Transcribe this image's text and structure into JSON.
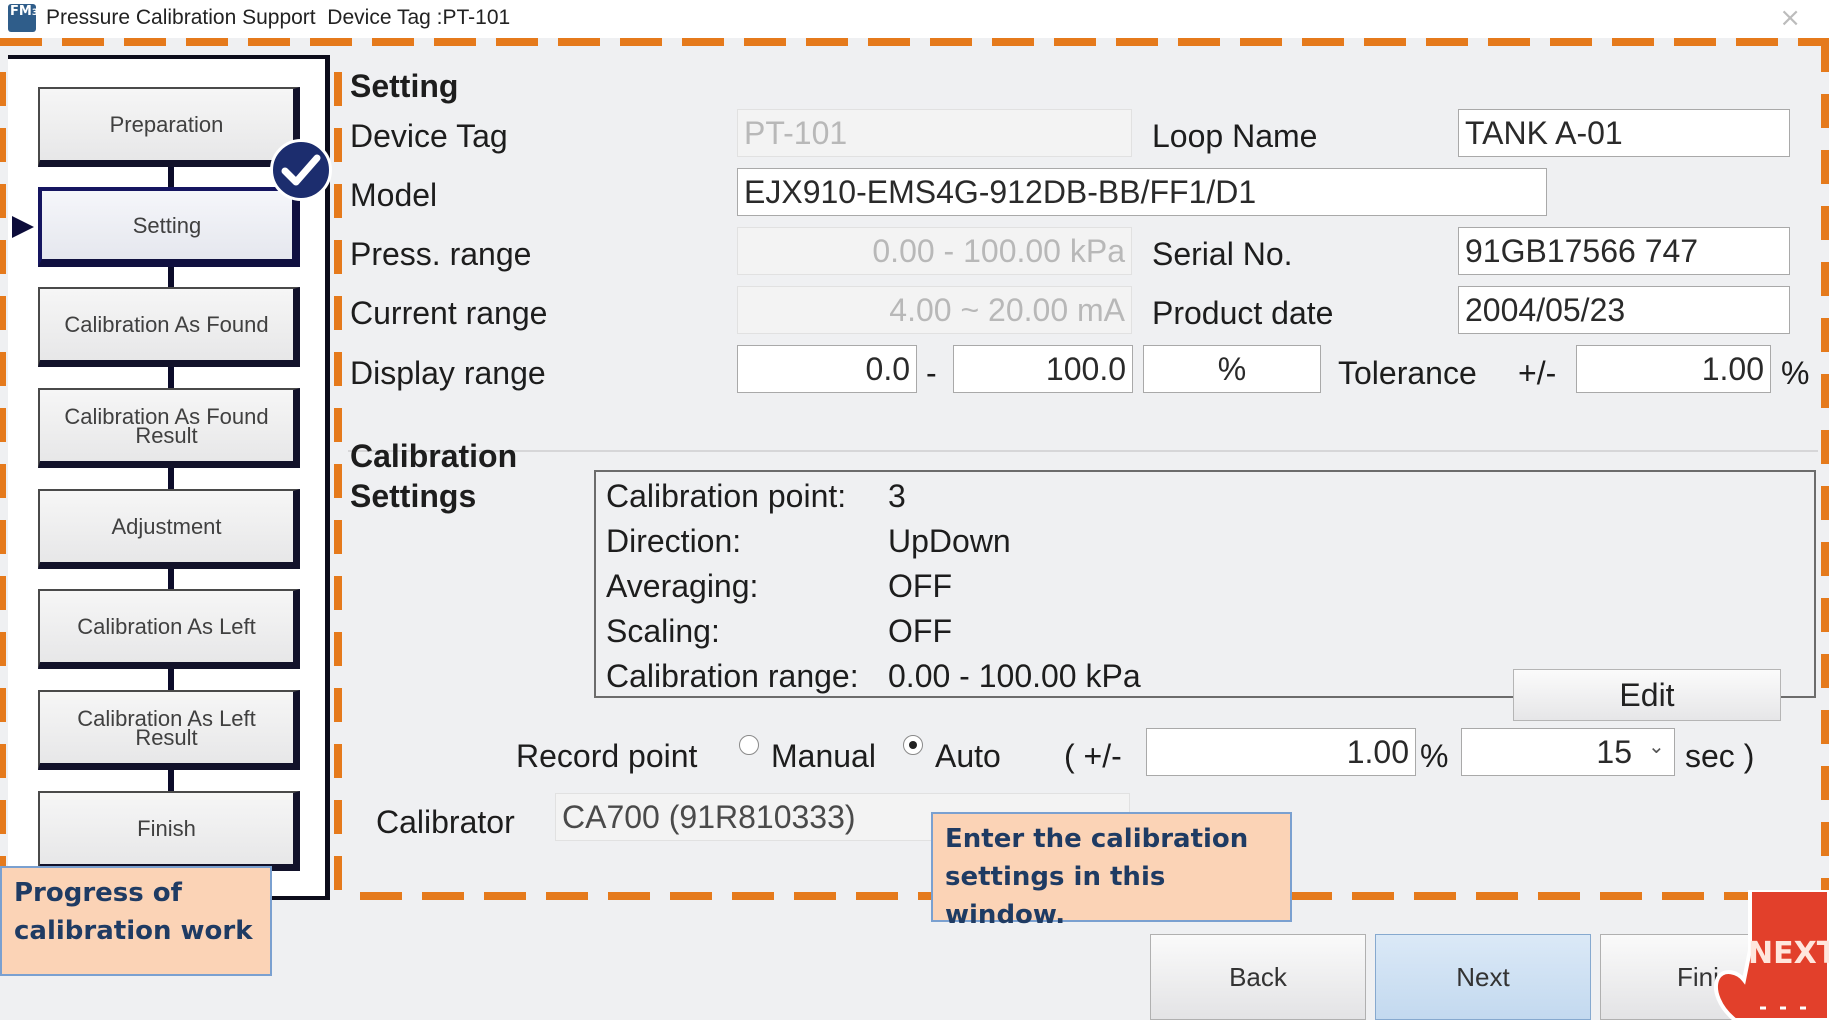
{
  "window": {
    "title": "Pressure Calibration Support  Device Tag :PT-101",
    "app_icon": "FM",
    "app_icon_sub": "3",
    "close_icon": "×"
  },
  "steps": [
    {
      "label": "Preparation",
      "state": "done"
    },
    {
      "label": "Setting",
      "state": "current"
    },
    {
      "label": "Calibration As Found",
      "state": "pending"
    },
    {
      "label": "Calibration As Found Result",
      "state": "pending"
    },
    {
      "label": "Adjustment",
      "state": "pending"
    },
    {
      "label": "Calibration As Left",
      "state": "pending"
    },
    {
      "label": "Calibration As Left Result",
      "state": "pending"
    },
    {
      "label": "Finish",
      "state": "pending"
    }
  ],
  "setting": {
    "section_title": "Setting",
    "device_tag_label": "Device Tag",
    "device_tag": "PT-101",
    "loop_name_label": "Loop Name",
    "loop_name": "TANK A-01",
    "model_label": "Model",
    "model": "EJX910-EMS4G-912DB-BB/FF1/D1",
    "press_range_label": "Press. range",
    "press_range": "0.00 - 100.00 kPa",
    "serial_label": "Serial No.",
    "serial": "91GB17566 747",
    "current_range_label": "Current range",
    "current_range": "4.00 ~ 20.00 mA",
    "product_date_label": "Product date",
    "product_date": "2004/05/23",
    "display_range_label": "Display range",
    "display_min": "0.0",
    "display_dash": "-",
    "display_max": "100.0",
    "display_unit": "%",
    "tolerance_label": "Tolerance",
    "tolerance_pm": "+/-",
    "tolerance": "1.00",
    "tolerance_unit": "%"
  },
  "calibration": {
    "section_title_1": "Calibration",
    "section_title_2": "Settings",
    "rows": [
      {
        "label": "Calibration point:",
        "value": "3"
      },
      {
        "label": "Direction:",
        "value": "UpDown"
      },
      {
        "label": "Averaging:",
        "value": "OFF"
      },
      {
        "label": "Scaling:",
        "value": "OFF"
      },
      {
        "label": "Calibration range:",
        "value": "0.00 - 100.00 kPa"
      }
    ],
    "edit_label": "Edit",
    "record_point_label": "Record point",
    "manual_label": "Manual",
    "auto_label": "Auto",
    "selected_mode": "Auto",
    "paren_open": "( +/-",
    "record_tolerance": "1.00",
    "record_tolerance_unit": "%",
    "record_seconds": "15",
    "sec_label": "sec )",
    "calibrator_label": "Calibrator",
    "calibrator": "CA700 (91R810333)"
  },
  "nav": {
    "back": "Back",
    "next": "Next",
    "finish": "Fini"
  },
  "callouts": {
    "progress": [
      "Progress of",
      "calibration work"
    ],
    "enter": [
      "Enter the calibration",
      "settings in this window."
    ],
    "next_hand": "NEXT"
  },
  "colors": {
    "accent_orange": "#e57a1c",
    "step_border": "#12122a",
    "callout_bg": "#fbd3b6",
    "callout_text": "#1f3b63",
    "primary_button": "#c3d9ef",
    "hand_red": "#e2402b"
  }
}
